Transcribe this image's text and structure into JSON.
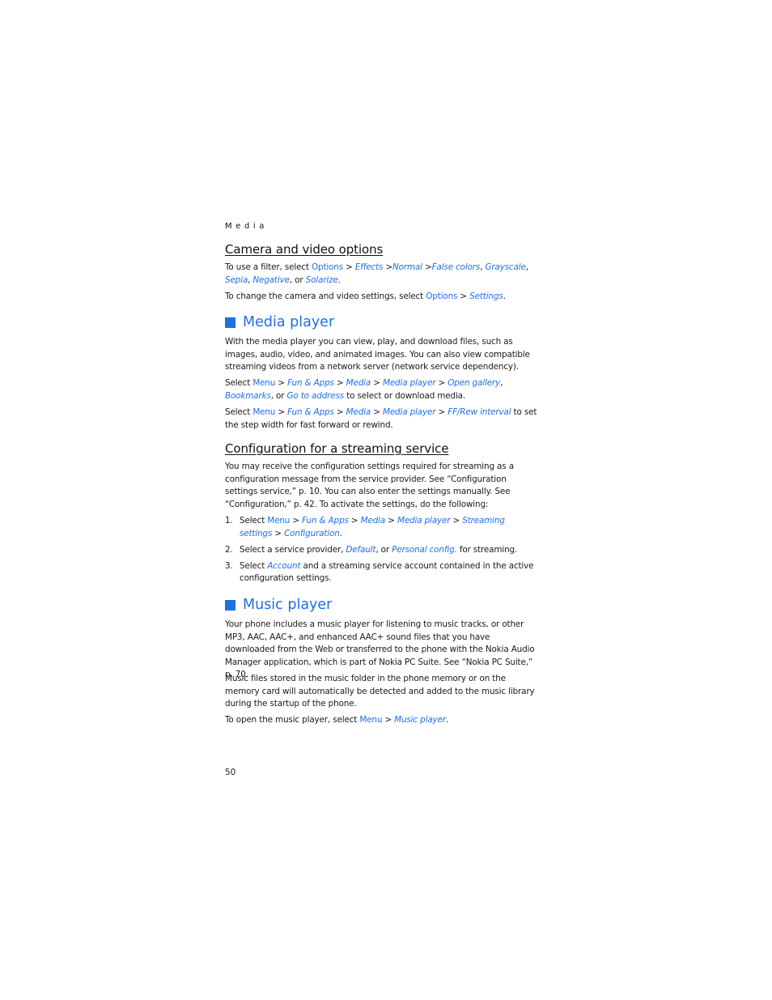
{
  "running_head": "Media",
  "page_number": "50",
  "accent_color": "#1f6fe5",
  "camera": {
    "heading": "Camera and video options",
    "p1": {
      "t1": "To use a filter, select ",
      "k1": "Options",
      "s1": " > ",
      "i1": "Effects",
      "s2": " >",
      "i2": "Normal",
      "s3": " >",
      "i3": "False colors",
      "s4": ", ",
      "i4": "Grayscale",
      "s5": ", ",
      "i5": "Sepia",
      "s6": ", ",
      "i6": "Negative",
      "s7": ", or ",
      "i7": "Solarize",
      "s8": "."
    },
    "p2": {
      "t1": "To change the camera and video settings, select ",
      "k1": "Options",
      "s1": " > ",
      "i1": "Settings",
      "s2": "."
    }
  },
  "media_player": {
    "heading": "Media player",
    "p1": "With the media player you can view, play, and download files, such as images, audio, video, and animated images. You can also view compatible streaming videos from a network server (network service dependency).",
    "p2": {
      "t1": "Select ",
      "k1": "Menu",
      "s1": " > ",
      "i1": "Fun & Apps",
      "s2": " > ",
      "i2": "Media",
      "s3": " > ",
      "i3": "Media player",
      "s4": " > ",
      "i4": "Open gallery",
      "s5": ", ",
      "i5": "Bookmarks",
      "s6": ", or ",
      "i6": "Go to address",
      "s7": " to select or download media."
    },
    "p3": {
      "t1": "Select ",
      "k1": "Menu",
      "s1": " > ",
      "i1": "Fun & Apps",
      "s2": " > ",
      "i2": "Media",
      "s3": " > ",
      "i3": "Media player",
      "s4": " > ",
      "i4": "FF/Rew interval",
      "s5": " to set the step width for fast forward or rewind."
    }
  },
  "streaming": {
    "heading": "Configuration for a streaming service",
    "p1": "You may receive the configuration settings required for streaming as a configuration message from the service provider. See “Configuration settings service,” p. 10. You can also enter the settings manually. See “Configuration,” p. 42. To activate the settings, do the following:",
    "steps": [
      {
        "num": "1.",
        "t1": "Select ",
        "k1": "Menu",
        "s1": " > ",
        "i1": "Fun & Apps",
        "s2": " > ",
        "i2": "Media",
        "s3": " > ",
        "i3": "Media player",
        "s4": " > ",
        "i4": "Streaming settings",
        "s5": " > ",
        "i5": "Configuration",
        "s6": "."
      },
      {
        "num": "2.",
        "t1": "Select a service provider, ",
        "i1": "Default",
        "s1": ", or ",
        "i2": "Personal config.",
        "s2": " for streaming."
      },
      {
        "num": "3.",
        "t1": "Select ",
        "i1": "Account",
        "s1": " and a streaming service account contained in the active configuration settings."
      }
    ]
  },
  "music_player": {
    "heading": "Music player",
    "p1": "Your phone includes a music player for listening to music tracks, or other MP3, AAC, AAC+, and enhanced AAC+ sound files that you have downloaded from the Web or transferred to the phone with the Nokia Audio Manager application, which is part of Nokia PC Suite. See “Nokia PC Suite,” p. 70.",
    "p2": "Music files stored in the music folder in the phone memory or on the memory card will automatically be detected and added to the music library during the startup of the phone.",
    "p3": {
      "t1": "To open the music player, select ",
      "k1": "Menu",
      "s1": " > ",
      "i1": "Music player",
      "s2": "."
    }
  }
}
